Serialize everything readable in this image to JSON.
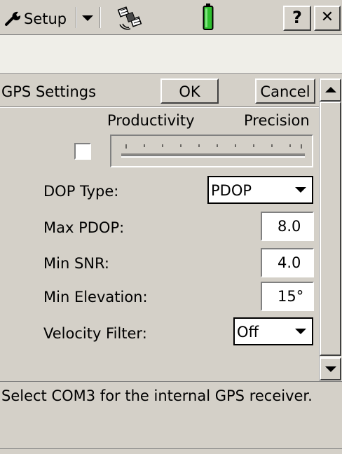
{
  "toolbar": {
    "setup_label": "Setup",
    "help_label": "?",
    "close_label": "✕"
  },
  "form": {
    "title": "GPS Settings",
    "ok_label": "OK",
    "cancel_label": "Cancel",
    "slider_left_label": "Productivity",
    "slider_right_label": "Precision",
    "dop_type_label": "DOP Type:",
    "dop_type_value": "PDOP",
    "max_pdop_label": "Max PDOP:",
    "max_pdop_value": "8.0",
    "min_snr_label": "Min SNR:",
    "min_snr_value": "4.0",
    "min_elevation_label": "Min Elevation:",
    "min_elevation_value": "15°",
    "velocity_filter_label": "Velocity Filter:",
    "velocity_filter_value": "Off"
  },
  "message": {
    "text": "Select COM3 for the internal GPS receiver."
  },
  "colors": {
    "face": "#d4d0c8",
    "battery": "#2fbf2f"
  },
  "icons": [
    "wrench-icon",
    "chevron-down-icon",
    "satellite-icon",
    "battery-icon",
    "help-icon",
    "close-icon",
    "arrow-up-icon",
    "arrow-down-icon"
  ]
}
